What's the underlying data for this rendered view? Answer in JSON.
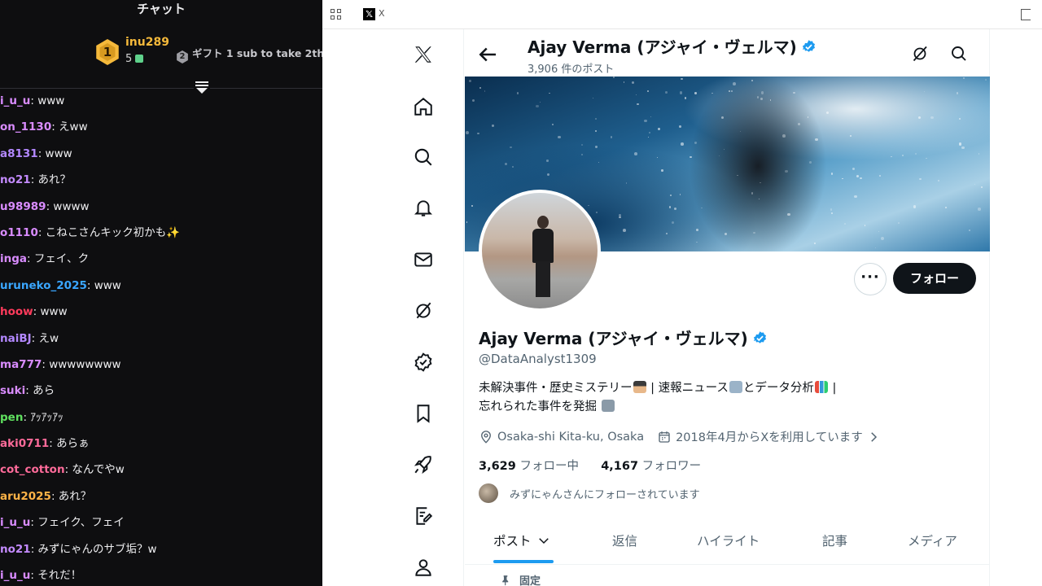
{
  "chat": {
    "title": "チャット",
    "leader": {
      "rank": "1",
      "name": "inu289",
      "count": "5"
    },
    "runner_up": {
      "rank": "2",
      "text": "ギフト 1 sub to take 2th"
    },
    "messages": [
      {
        "user": "i_u_u",
        "text": "www",
        "color": "#d98cff"
      },
      {
        "user": "on_1130",
        "text": "えww",
        "color": "#d98cff"
      },
      {
        "user": "a8131",
        "text": "www",
        "color": "#b388ff"
      },
      {
        "user": "no21",
        "text": "あれ？",
        "color": "#c48bff"
      },
      {
        "user": "u98989",
        "text": "wwww",
        "color": "#d98cff"
      },
      {
        "user": "o1110",
        "text": "こねこさんキック初かも✨",
        "color": "#d98cff"
      },
      {
        "user": "inga",
        "text": "フェイ、ク",
        "color": "#d98cff"
      },
      {
        "user": "uruneko_2025",
        "text": "www",
        "color": "#3aa6ff"
      },
      {
        "user": "hoow",
        "text": "www",
        "color": "#ff3b5c"
      },
      {
        "user": "naiBJ",
        "text": "えw",
        "color": "#b388ff"
      },
      {
        "user": "ma777",
        "text": "wwwwwwww",
        "color": "#d98cff"
      },
      {
        "user": "suki",
        "text": "あら",
        "color": "#d98cff"
      },
      {
        "user": "pen",
        "text": "ｱｯｱｯｱｯ",
        "color": "#5fe05f"
      },
      {
        "user": "aki0711",
        "text": "あらぁ",
        "color": "#ff6b9a"
      },
      {
        "user": "cot_cotton",
        "text": "なんでやw",
        "color": "#ff6b9a"
      },
      {
        "user": "aru2025",
        "text": "あれ？",
        "color": "#ffb347"
      },
      {
        "user": "i_u_u",
        "text": "フェイク、フェイ",
        "color": "#d98cff"
      },
      {
        "user": "no21",
        "text": "みずにゃんのサブ垢？w",
        "color": "#c48bff"
      },
      {
        "user": "i_u_u",
        "text": "それだ！",
        "color": "#d98cff"
      }
    ]
  },
  "browser": {
    "tab_title": "X",
    "header": {
      "name": "Ajay Verma (アジャイ・ヴェルマ)",
      "posts": "3,906 件のポスト"
    },
    "profile": {
      "name": "Ajay Verma (アジャイ・ヴェルマ)",
      "handle": "@DataAnalyst1309",
      "bio_line1_a": "未解決事件・歴史ミステリー",
      "bio_line1_b": " | 速報ニュース",
      "bio_line1_c": "とデータ分析",
      "bio_line1_d": " |",
      "bio_line2": "忘れられた事件を発掘 ",
      "location": "Osaka-shi Kita-ku, Osaka",
      "joined": "2018年4月からXを利用しています",
      "following_count": "3,629",
      "following_label": " フォロー中",
      "followers_count": "4,167",
      "followers_label": " フォロワー",
      "followed_by": "みずにゃんさんにフォローされています",
      "more_label": "···",
      "follow_label": "フォロー"
    },
    "tabs": [
      "ポスト",
      "返信",
      "ハイライト",
      "記事",
      "メディア"
    ],
    "pinned": "固定",
    "colors": {
      "accent": "#1d9bf0",
      "verified": "#1d9bf0"
    }
  }
}
